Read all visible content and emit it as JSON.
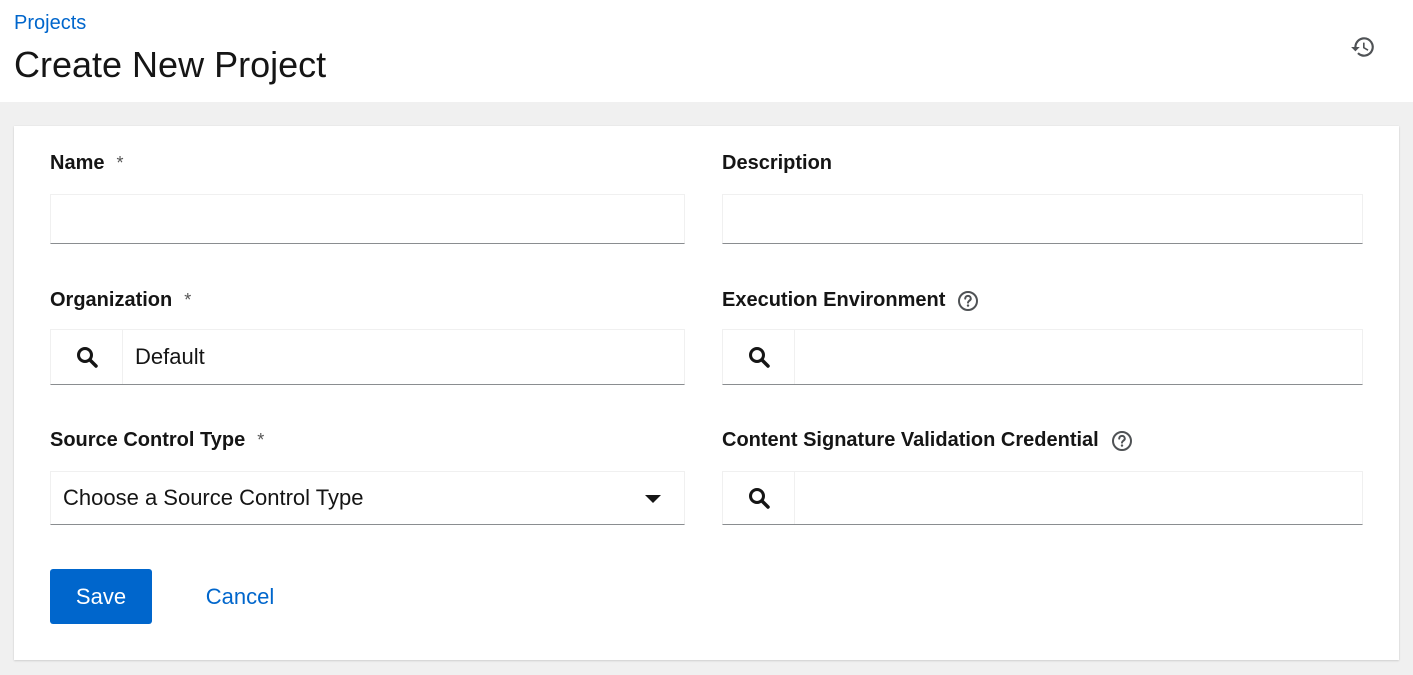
{
  "breadcrumb": {
    "label": "Projects"
  },
  "page": {
    "title": "Create New Project"
  },
  "header": {
    "history_icon": "history-icon"
  },
  "form": {
    "name": {
      "label": "Name",
      "required_mark": "*",
      "value": ""
    },
    "description": {
      "label": "Description",
      "value": ""
    },
    "organization": {
      "label": "Organization",
      "required_mark": "*",
      "value": "Default"
    },
    "execution_environment": {
      "label": "Execution Environment",
      "value": ""
    },
    "source_control_type": {
      "label": "Source Control Type",
      "required_mark": "*",
      "value": "Choose a Source Control Type"
    },
    "content_signature": {
      "label": "Content Signature Validation Credential",
      "value": ""
    }
  },
  "actions": {
    "save_label": "Save",
    "cancel_label": "Cancel"
  },
  "colors": {
    "accent": "#0066cc",
    "text": "#151515",
    "background": "#f0f0f0",
    "border": "#8a8d90"
  }
}
